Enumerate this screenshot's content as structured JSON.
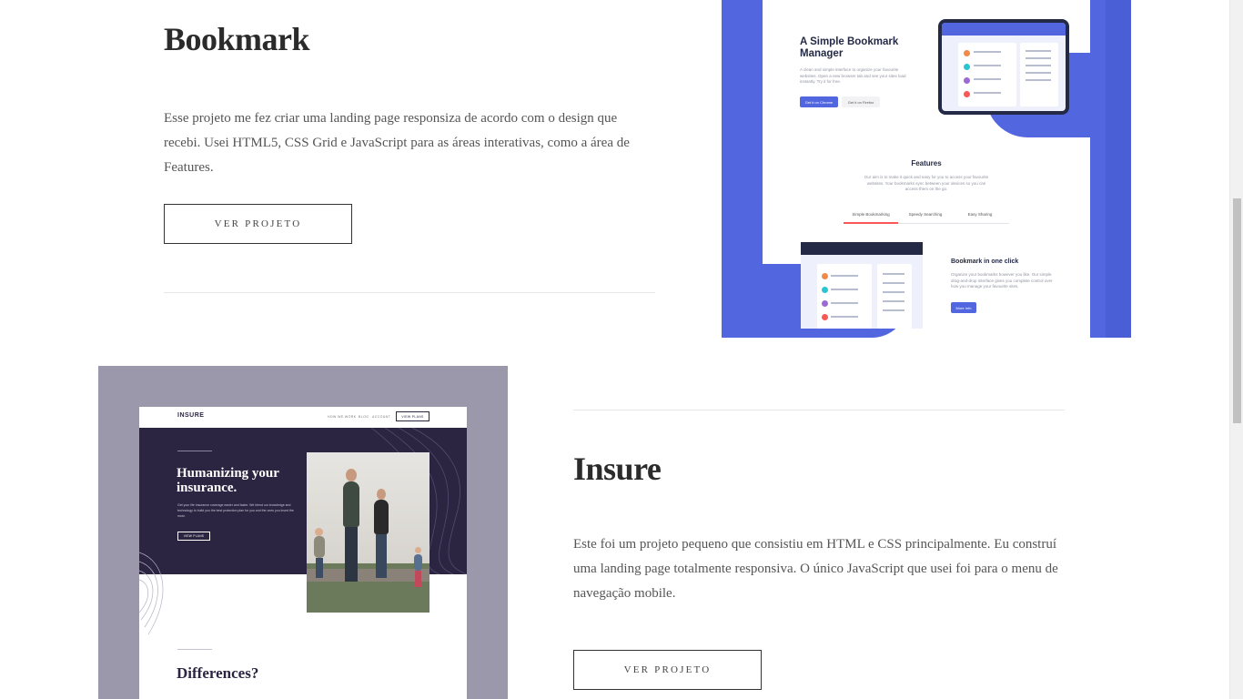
{
  "projects": [
    {
      "title": "Bookmark",
      "description": "Esse projeto me fez criar uma landing page responsiza de acordo com o design que recebi. Usei HTML5, CSS Grid e JavaScript para as áreas interativas, como a área de Features.",
      "button_label": "VER PROJETO",
      "preview": {
        "hero_title": "A Simple Bookmark Manager",
        "hero_text": "A clean and simple interface to organize your favourite websites. Open a new browser tab and see your sites load instantly. Try it for free.",
        "btn_chrome": "Get it on Chrome",
        "btn_firefox": "Get it on Firefox",
        "features_title": "Features",
        "features_text": "Our aim is to make it quick and easy for you to access your favourite websites. Your bookmarks sync between your devices so you can access them on the go.",
        "tabs": [
          "Simple Bookmarking",
          "Speedy Searching",
          "Easy Sharing"
        ],
        "feature_heading": "Bookmark in one click",
        "feature_text": "Organize your bookmarks however you like. Our simple drag-and-drop interface gives you complete control over how you manage your favourite sites.",
        "more_info": "More Info"
      }
    },
    {
      "title": "Insure",
      "description": "Este foi um projeto pequeno que consistiu em HTML e CSS principalmente. Eu construí uma landing page totalmente responsiva. O único JavaScript que usei foi para o menu de navegação mobile.",
      "button_label": "VER PROJETO",
      "preview": {
        "logo": "INSURE",
        "nav": [
          "HOW WE WORK",
          "BLOG",
          "ACCOUNT"
        ],
        "nav_cta": "VIEW PLANS",
        "hero_title": "Humanizing your insurance.",
        "hero_text": "Get your life insurance coverage easier and faster. We blend our knowledge and technology to build you the best protection plan for you and the ones you loved the most.",
        "hero_cta": "VIEW PLANS",
        "section_title": "Differences?"
      }
    }
  ],
  "colors": {
    "bookmark_blue": "#5267df",
    "bookmark_navy": "#242a45",
    "bookmark_red": "#fa5757",
    "insure_purple": "#2c2541",
    "insure_frame": "#9a98aa"
  }
}
